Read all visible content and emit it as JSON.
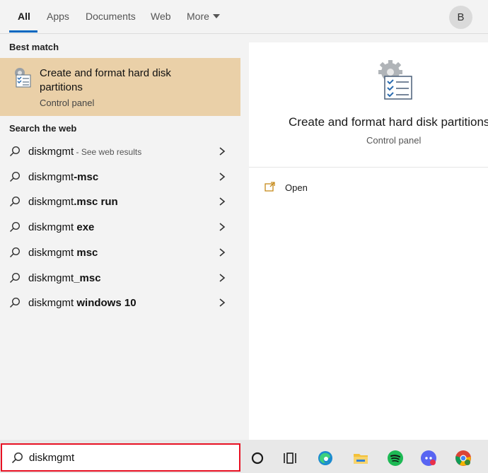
{
  "tabs": {
    "all": "All",
    "apps": "Apps",
    "documents": "Documents",
    "web": "Web",
    "more": "More"
  },
  "user": {
    "avatar_letter": "B"
  },
  "left": {
    "best_match_label": "Best match",
    "best_match": {
      "title": "Create and format hard disk partitions",
      "subtitle": "Control panel",
      "icon": "disk-management-icon"
    },
    "search_web_label": "Search the web",
    "web_results": [
      {
        "prefix": "diskmgmt",
        "bold": "",
        "hint": " - See web results"
      },
      {
        "prefix": "diskmgmt",
        "bold": "-msc",
        "hint": ""
      },
      {
        "prefix": "diskmgmt",
        "bold": ".msc run",
        "hint": ""
      },
      {
        "prefix": "diskmgmt",
        "bold": " exe",
        "hint": ""
      },
      {
        "prefix": "diskmgmt",
        "bold": " msc",
        "hint": ""
      },
      {
        "prefix": "diskmgmt",
        "bold": "_msc",
        "hint": ""
      },
      {
        "prefix": "diskmgmt",
        "bold": " windows 10",
        "hint": ""
      }
    ]
  },
  "right": {
    "title": "Create and format hard disk partitions",
    "subtitle": "Control panel",
    "actions": [
      {
        "label": "Open",
        "icon": "open-icon"
      }
    ]
  },
  "search": {
    "value": "diskmgmt"
  },
  "taskbar": {
    "icons": [
      "cortana-icon",
      "task-view-icon",
      "edge-icon",
      "file-explorer-icon",
      "spotify-icon",
      "discord-icon",
      "chrome-icon"
    ]
  },
  "colors": {
    "best_match_bg": "#ead0a8",
    "accent": "#0067c0",
    "search_border": "#e81123"
  }
}
